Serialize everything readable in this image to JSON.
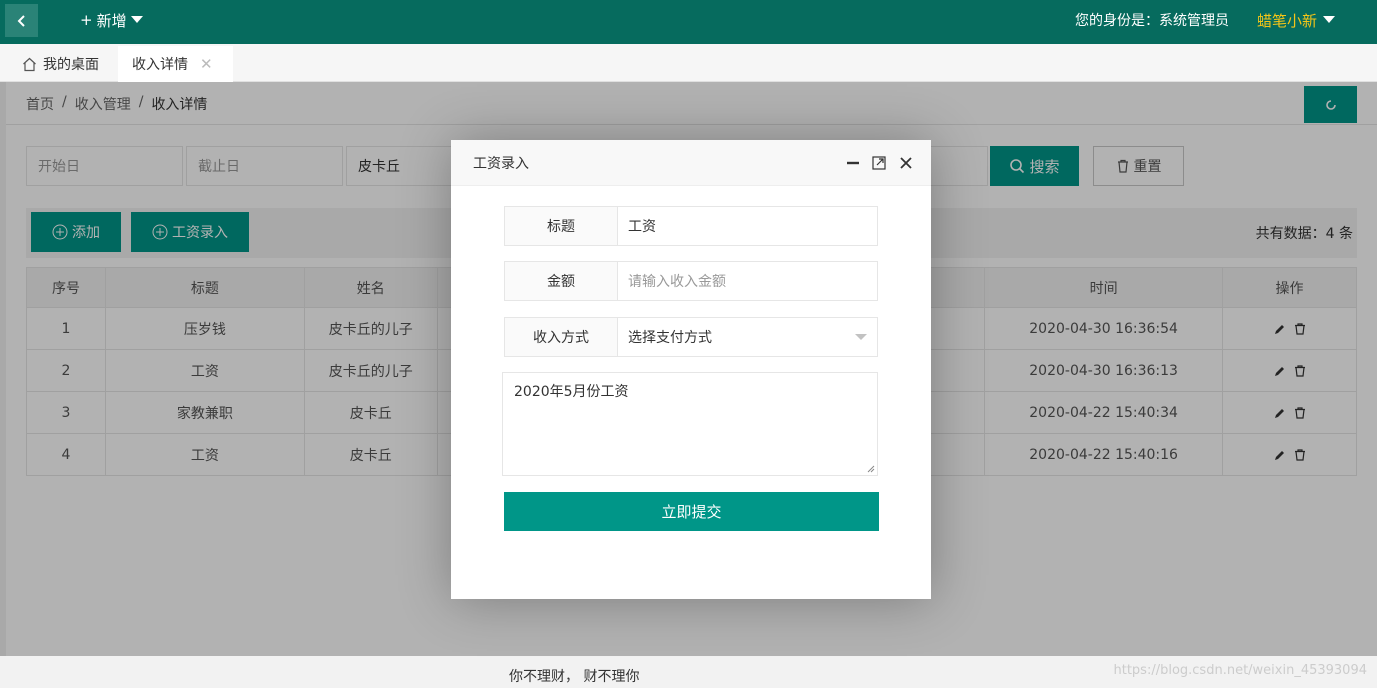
{
  "header": {
    "new_label": "新增",
    "identity": "您的身份是：系统管理员",
    "username": "蜡笔小新"
  },
  "tabs": {
    "home": "我的桌面",
    "active": "收入详情"
  },
  "breadcrumb": [
    "首页",
    "收入管理",
    "收入详情"
  ],
  "filters": {
    "start_placeholder": "开始日",
    "end_placeholder": "截止日",
    "name_value": "皮卡丘",
    "search_label": "搜索",
    "reset_label": "重置"
  },
  "toolbar": {
    "add_label": "添加",
    "salary_label": "工资录入",
    "total_text": "共有数据：4 条"
  },
  "table": {
    "headers": [
      "序号",
      "标题",
      "姓名",
      "时间",
      "操作"
    ],
    "rows": [
      {
        "no": "1",
        "title": "压岁钱",
        "name": "皮卡丘的儿子",
        "time": "2020-04-30 16:36:54"
      },
      {
        "no": "2",
        "title": "工资",
        "name": "皮卡丘的儿子",
        "time": "2020-04-30 16:36:13"
      },
      {
        "no": "3",
        "title": "家教兼职",
        "name": "皮卡丘",
        "time": "2020-04-22 15:40:34"
      },
      {
        "no": "4",
        "title": "工资",
        "name": "皮卡丘",
        "time": "2020-04-22 15:40:16"
      }
    ]
  },
  "modal": {
    "title": "工资录入",
    "title_label": "标题",
    "title_value": "工资",
    "amount_label": "金额",
    "amount_placeholder": "请输入收入金额",
    "method_label": "收入方式",
    "method_value": "选择支付方式",
    "note_value": "2020年5月份工资",
    "submit_label": "立即提交"
  },
  "footer": {
    "text": "你不理财， 财不理你",
    "watermark": "https://blog.csdn.net/weixin_45393094"
  },
  "colors": {
    "header_bg": "#066b5e",
    "primary": "#009688",
    "accent_user": "#f5c518"
  }
}
